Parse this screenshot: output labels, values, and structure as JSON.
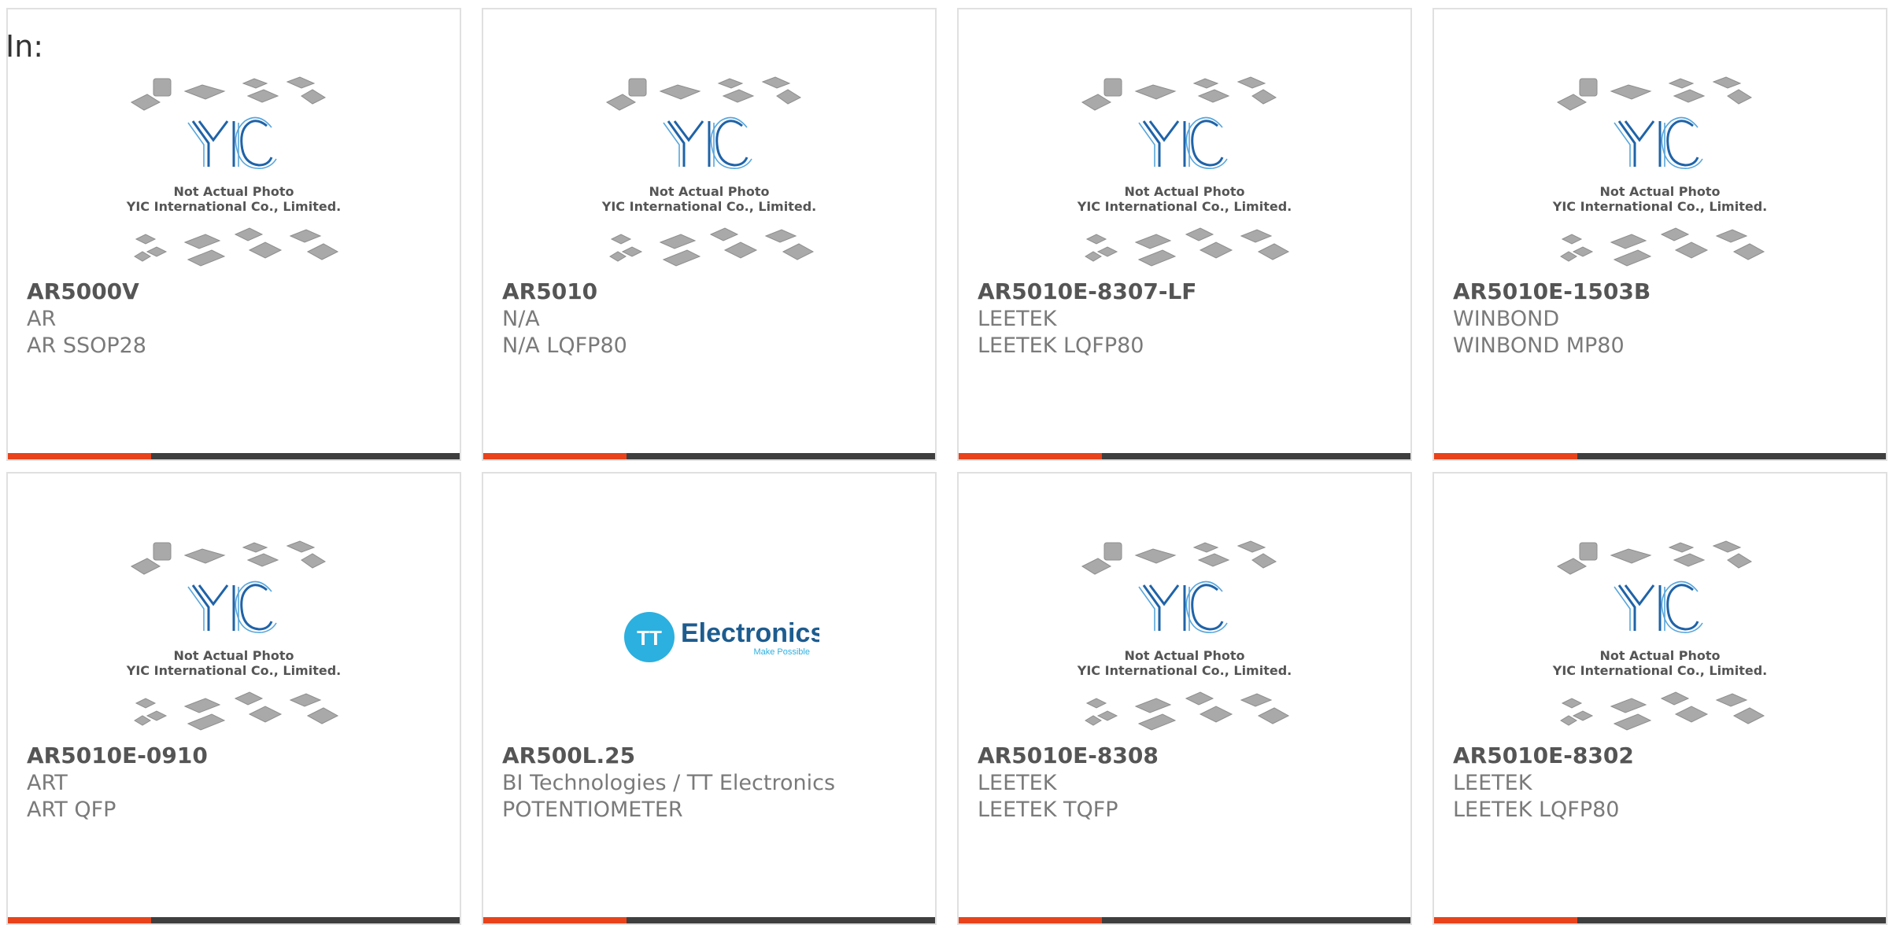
{
  "header": {
    "in_label": "In:"
  },
  "placeholder_image": {
    "logo_text": "YIC",
    "caption_line1": "Not Actual Photo",
    "caption_line2": "YIC International Co., Limited."
  },
  "tt_logo": {
    "monogram": "TT",
    "name": "Electronics",
    "tagline": "Make Possible"
  },
  "colors": {
    "accent": "#e8431b",
    "bar": "#3f3f3f",
    "yic_blue": "#1f63a8",
    "tt_cyan": "#2bb0e0",
    "tt_navy": "#1d5c8f"
  },
  "products": [
    {
      "part": "AR5000V",
      "manufacturer": "AR",
      "description": "AR SSOP28",
      "image": "yic-placeholder"
    },
    {
      "part": "AR5010",
      "manufacturer": "N/A",
      "description": "N/A LQFP80",
      "image": "yic-placeholder"
    },
    {
      "part": "AR5010E-8307-LF",
      "manufacturer": "LEETEK",
      "description": "LEETEK LQFP80",
      "image": "yic-placeholder"
    },
    {
      "part": "AR5010E-1503B",
      "manufacturer": "WINBOND",
      "description": "WINBOND MP80",
      "image": "yic-placeholder"
    },
    {
      "part": "AR5010E-0910",
      "manufacturer": "ART",
      "description": "ART QFP",
      "image": "yic-placeholder"
    },
    {
      "part": "AR500L.25",
      "manufacturer": "BI Technologies / TT Electronics",
      "description": "POTENTIOMETER",
      "image": "tt-electronics-logo"
    },
    {
      "part": "AR5010E-8308",
      "manufacturer": "LEETEK",
      "description": "LEETEK TQFP",
      "image": "yic-placeholder"
    },
    {
      "part": "AR5010E-8302",
      "manufacturer": "LEETEK",
      "description": "LEETEK LQFP80",
      "image": "yic-placeholder"
    }
  ]
}
